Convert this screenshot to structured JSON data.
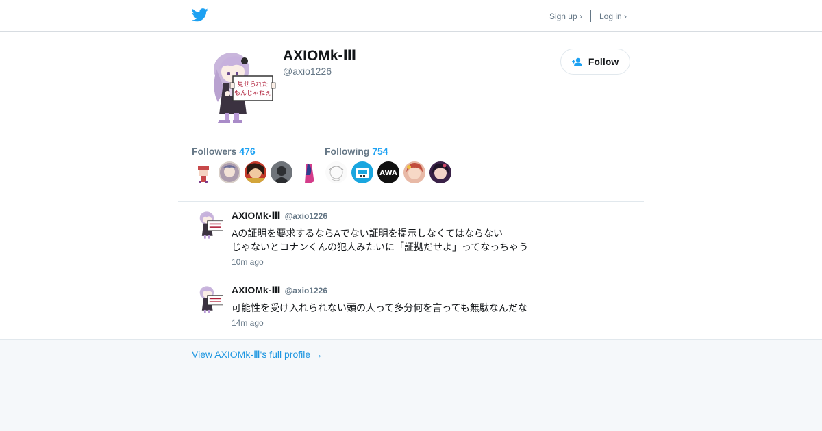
{
  "header": {
    "logo_icon": "twitter-bird-icon",
    "signup_label": "Sign up ›",
    "login_label": "Log in ›"
  },
  "profile": {
    "name": "AXIOMk-Ⅲ",
    "handle": "@axio1226",
    "follow_label": "Follow",
    "followers_label": "Followers",
    "followers_count": "476",
    "following_label": "Following",
    "following_count": "754"
  },
  "tweets": [
    {
      "name": "AXIOMk-Ⅲ",
      "handle": "@axio1226",
      "text": "Aの証明を要求するならAでない証明を提示しなくてはならない\nじゃないとコナンくんの犯人みたいに「証拠だせよ」ってなっちゃう",
      "time": "10m ago"
    },
    {
      "name": "AXIOMk-Ⅲ",
      "handle": "@axio1226",
      "text": "可能性を受け入れられない頭の人って多分何を言っても無駄なんだな",
      "time": "14m ago"
    }
  ],
  "footer": {
    "full_profile_link": "View AXIOMk-Ⅲ's full profile →"
  },
  "colors": {
    "accent": "#1da1f2",
    "link": "#1b95e0",
    "muted": "#657786",
    "background": "#f5f8fa"
  }
}
